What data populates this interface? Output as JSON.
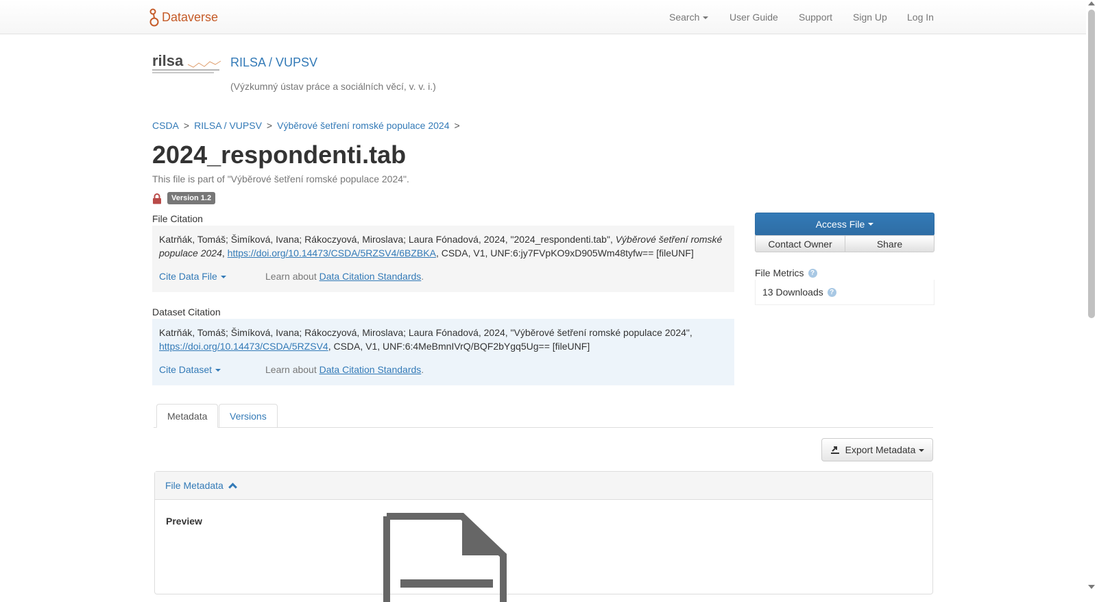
{
  "navbar": {
    "brand": "Dataverse",
    "search_label": "Search",
    "user_guide": "User Guide",
    "support": "Support",
    "sign_up": "Sign Up",
    "log_in": "Log In"
  },
  "dataverse": {
    "logo_text": "rilsa",
    "name": "RILSA / VUPSV",
    "affiliation": "(Výzkumný ústav práce a sociálních věcí, v. v. i.)"
  },
  "breadcrumb": [
    "CSDA",
    "RILSA / VUPSV",
    "Výběrové šetření romské populace 2024"
  ],
  "breadcrumb_sep": ">",
  "file": {
    "title": "2024_respondenti.tab",
    "part_of": "This file is part of \"Výběrové šetření romské populace 2024\".",
    "version": "Version 1.2"
  },
  "file_citation": {
    "label": "File Citation",
    "text_before": "Katrňák, Tomáš; Šimíková, Ivana; Rákoczyová, Miroslava; Laura Fónadová, 2024, \"2024_respondenti.tab\", ",
    "italic": "Výběrové šetření romské populace 2024",
    "comma": ", ",
    "doi": "https://doi.org/10.14473/CSDA/5RZSV4/6BZBKA",
    "text_after": ", CSDA, V1, UNF:6:jy7FVpKO9xD905Wm48tyfw== [fileUNF]",
    "cite_button": "Cite Data File",
    "learn_prefix": "Learn about ",
    "learn_link": "Data Citation Standards",
    "learn_suffix": "."
  },
  "dataset_citation": {
    "label": "Dataset Citation",
    "text_before": "Katrňák, Tomáš; Šimíková, Ivana; Rákoczyová, Miroslava; Laura Fónadová, 2024, \"Výběrové šetření romské populace 2024\", ",
    "doi": "https://doi.org/10.14473/CSDA/5RZSV4",
    "text_after": ", CSDA, V1, UNF:6:4MeBmnIVrQ/BQF2bYgq5Ug== [fileUNF]",
    "cite_button": "Cite Dataset",
    "learn_prefix": "Learn about ",
    "learn_link": "Data Citation Standards",
    "learn_suffix": "."
  },
  "actions": {
    "access_file": "Access File",
    "contact_owner": "Contact Owner",
    "share": "Share"
  },
  "metrics": {
    "title": "File Metrics",
    "downloads": "13 Downloads"
  },
  "tabs": {
    "metadata": "Metadata",
    "versions": "Versions"
  },
  "export_metadata": "Export Metadata",
  "panel": {
    "heading": "File Metadata",
    "preview_label": "Preview"
  },
  "colors": {
    "brand": "#c55b28",
    "link": "#337ab7",
    "primary": "#337ab7",
    "lock": "#b94a48"
  },
  "icons": [
    "dataverse-logo-icon",
    "lock-icon",
    "help-icon",
    "export-icon",
    "chevron-up-icon",
    "file-icon",
    "caret-down-icon"
  ]
}
